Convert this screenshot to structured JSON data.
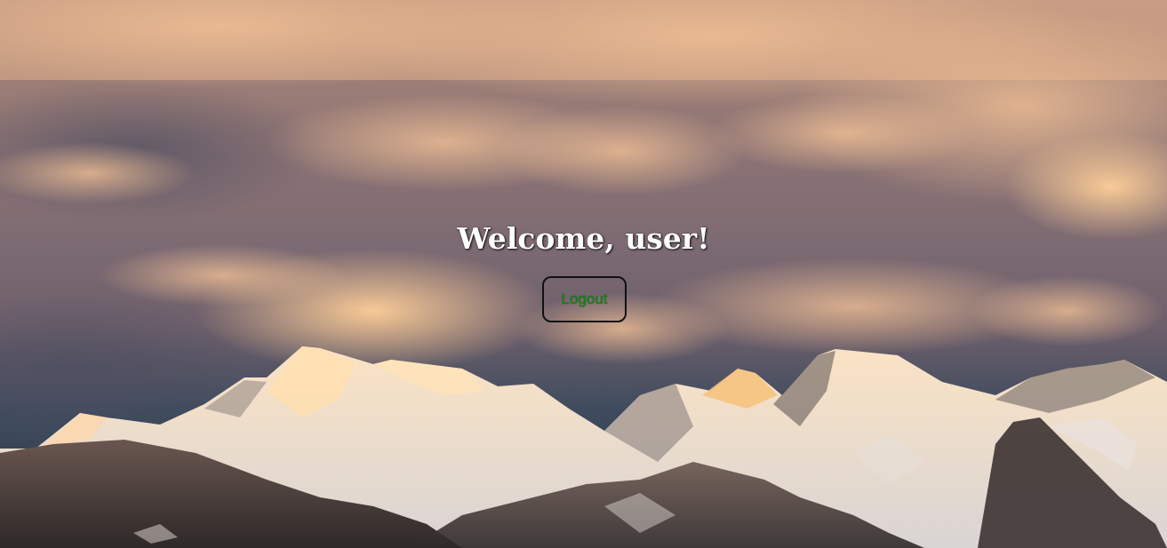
{
  "header": {
    "welcome_text": "Welcome, user!"
  },
  "actions": {
    "logout_label": "Logout"
  },
  "background": {
    "description_icon": "mountain-landscape-image",
    "colors": {
      "sky_warm": "#f3c493",
      "sky_cool": "#5a5a6e",
      "snow": "#f3ede8",
      "rock": "#4a3e3c"
    }
  },
  "colors": {
    "button_text": "#0a8a0a",
    "button_border": "#111111",
    "title_text": "#ffffff"
  }
}
